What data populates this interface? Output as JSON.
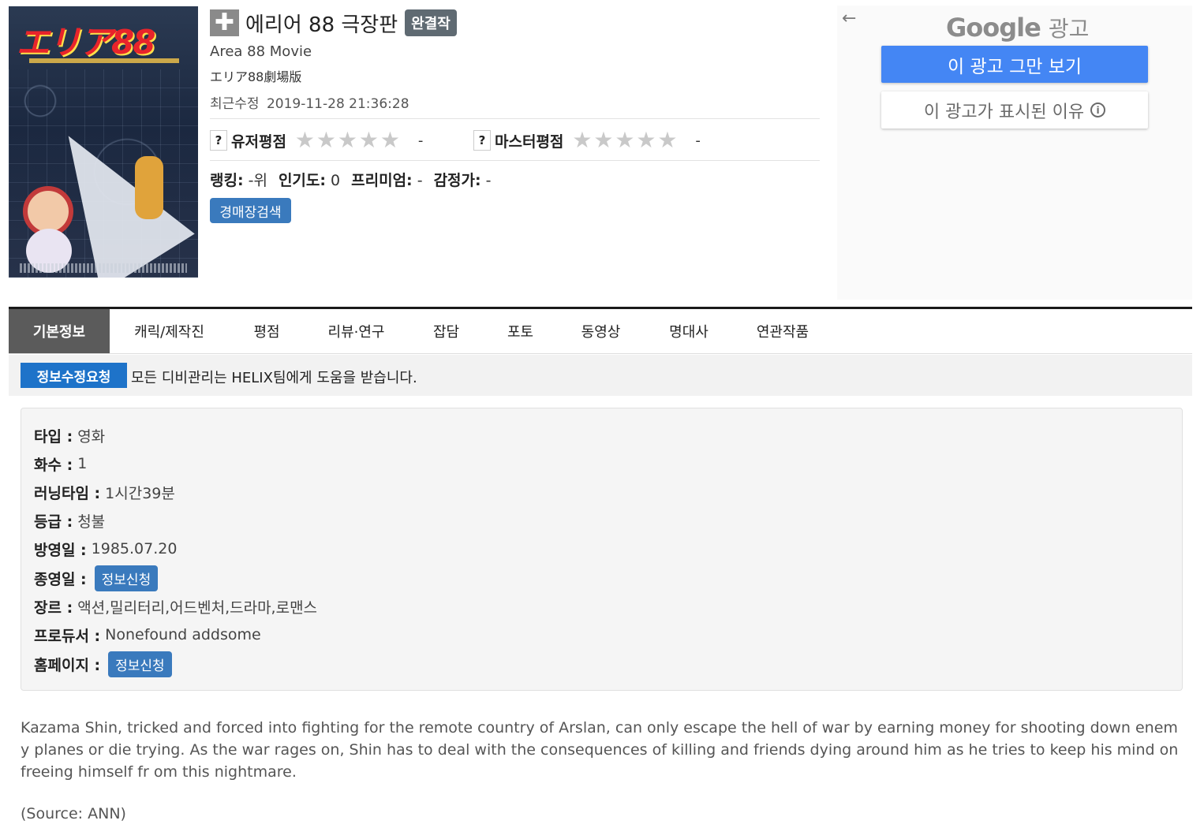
{
  "title": {
    "main": "에리어 88 극장판",
    "badge": "완결작",
    "add_symbol": "✚",
    "alternate": "Area 88 Movie",
    "japanese": "エリア88劇場版",
    "updated_label": "최근수정",
    "updated_value": "2019-11-28 21:36:28"
  },
  "poster": {
    "logo_text": "エリア88"
  },
  "ratings": {
    "help_symbol": "?",
    "user_label": "유저평점",
    "user_value": "-",
    "master_label": "마스터평점",
    "master_value": "-",
    "max_stars": 5,
    "filled_stars": 0,
    "star_color_empty": "#c9c9c9"
  },
  "stats": {
    "ranking_label": "랭킹:",
    "ranking_value": "-위",
    "popularity_label": "인기도:",
    "popularity_value": "0",
    "premium_label": "프리미엄:",
    "premium_value": "-",
    "appraisal_label": "감정가:",
    "appraisal_value": "-"
  },
  "auction_button": "경매장검색",
  "ad": {
    "back_arrow": "←",
    "brand": "Google",
    "word": "광고",
    "stop_button": "이 광고 그만 보기",
    "why_button": "이 광고가 표시된 이유",
    "info_symbol": "i",
    "stop_color": "#4486f4"
  },
  "tabs": [
    "기본정보",
    "캐릭/제작진",
    "평점",
    "리뷰·연구",
    "잡담",
    "포토",
    "동영상",
    "명대사",
    "연관작품"
  ],
  "notice": {
    "button": "정보수정요청",
    "text": "모든 디비관리는 HELIX팀에게 도움을 받습니다."
  },
  "info": {
    "type_label": "타입 :",
    "type_value": "영화",
    "episodes_label": "화수 :",
    "episodes_value": "1",
    "runtime_label": "러닝타임 :",
    "runtime_value": "1시간39분",
    "rating_label": "등급 :",
    "rating_value": "청불",
    "aired_label": "방영일 :",
    "aired_value": "1985.07.20",
    "ended_label": "종영일 :",
    "ended_button": "정보신청",
    "genre_label": "장르 :",
    "genre_value": "액션,밀리터리,어드벤처,드라마,로맨스",
    "producer_label": "프로듀서 :",
    "producer_value": "Nonefound addsome",
    "homepage_label": "홈페이지 :",
    "homepage_button": "정보신청"
  },
  "synopsis": "Kazama Shin, tricked and forced into fighting for the remote country of Arslan, can only escape the hell of war by earning money for shooting down enemy planes or die trying. As the war rages on, Shin has to deal with the consequences of killing and friends dying around him as he tries to keep his mind on freeing himself fr om this nightmare.",
  "source": "(Source: ANN)",
  "colors": {
    "primary_button": "#3a7abd",
    "notice_button": "#1e73c9",
    "active_tab": "#5b5b5b",
    "badge": "#5f6a72"
  }
}
